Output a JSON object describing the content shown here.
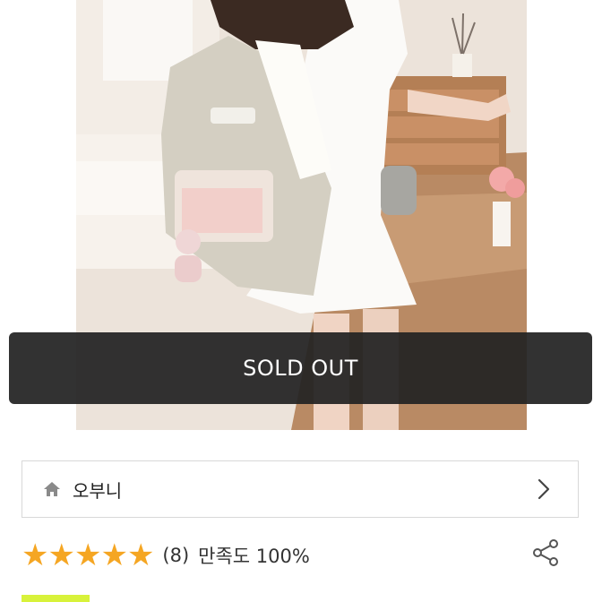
{
  "product": {
    "sold_out_label": "SOLD OUT",
    "image_alt": "Girl wearing beige backpack with floral pocket and teddy bear keychain"
  },
  "store": {
    "name": "오부니",
    "home_icon": "home-icon",
    "chevron_icon": "chevron-right-icon"
  },
  "rating": {
    "stars": 5,
    "count_text": "(8)",
    "satisfaction_text": "만족도 100%",
    "star_color": "#f5a623"
  },
  "share_icon": "share-icon",
  "colors": {
    "banner_bg": "#222222",
    "accent_tag": "#d8f23a"
  }
}
